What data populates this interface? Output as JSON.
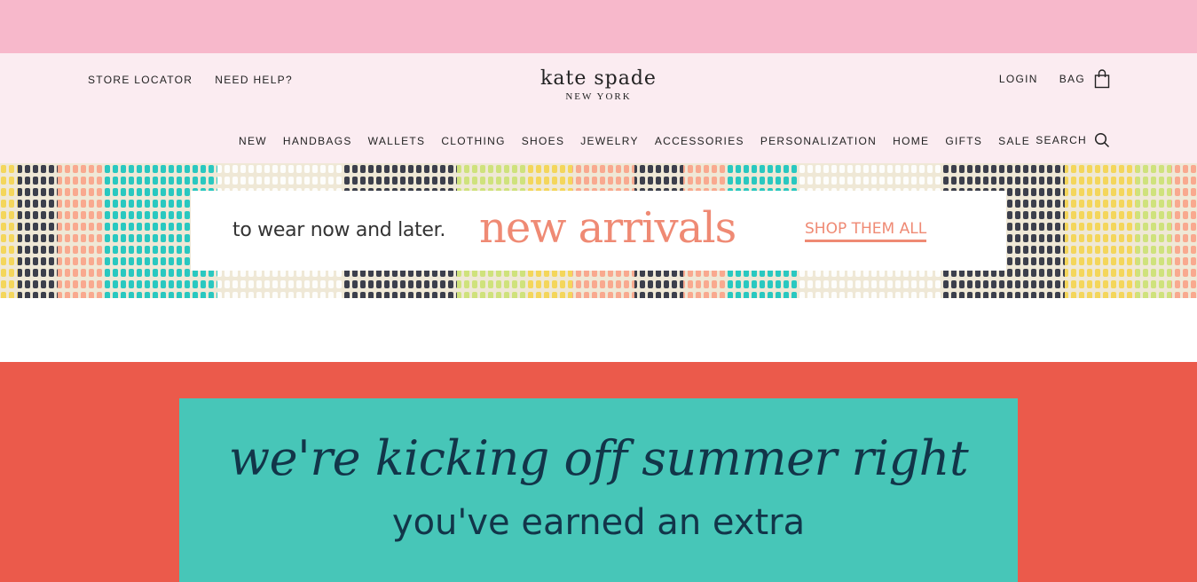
{
  "header": {
    "util_left": [
      "STORE LOCATOR",
      "NEED HELP?"
    ],
    "logo_main": "kate spade",
    "logo_sub": "NEW YORK",
    "login": "LOGIN",
    "bag": "BAG",
    "nav": [
      "NEW",
      "HANDBAGS",
      "WALLETS",
      "CLOTHING",
      "SHOES",
      "JEWELRY",
      "ACCESSORIES",
      "PERSONALIZATION",
      "HOME",
      "GIFTS",
      "SALE"
    ],
    "search": "SEARCH",
    "icons": {
      "bag": "shopping-bag-icon",
      "search": "search-icon"
    }
  },
  "banner": {
    "tagline": "to wear now and later.",
    "headline": "new arrivals",
    "cta": "SHOP THEM ALL"
  },
  "promo": {
    "line1": "we're kicking off summer right",
    "line2": "you've earned an extra"
  },
  "colors": {
    "top_strip": "#f7b8cb",
    "header_bg": "#fbecf1",
    "accent_coral": "#ef8a74",
    "promo_red": "#eb5a4b",
    "promo_teal": "#47c6b8",
    "promo_text": "#123549"
  }
}
